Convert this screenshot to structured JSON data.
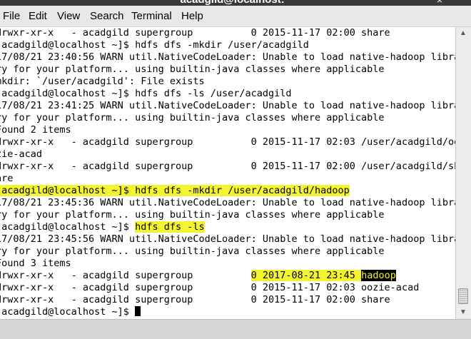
{
  "window": {
    "title": "acadgild@localhost:~",
    "close_glyph": "×"
  },
  "menu": [
    "File",
    "Edit",
    "View",
    "Search",
    "Terminal",
    "Help"
  ],
  "terminal": {
    "lines": [
      "drwxr-xr-x   - acadgild supergroup          0 2015-11-17 02:00 share",
      "[acadgild@localhost ~]$ hdfs dfs -mkdir /user/acadgild",
      "17/08/21 23:40:56 WARN util.NativeCodeLoader: Unable to load native-hadoop libra",
      "ry for your platform... using builtin-java classes where applicable",
      "mkdir: `/user/acadgild': File exists",
      "[acadgild@localhost ~]$ hdfs dfs -ls /user/acadgild",
      "17/08/21 23:41:25 WARN util.NativeCodeLoader: Unable to load native-hadoop libra",
      "ry for your platform... using builtin-java classes where applicable",
      "Found 2 items",
      "drwxr-xr-x   - acadgild supergroup          0 2015-11-17 02:03 /user/acadgild/oo",
      "zie-acad",
      "drwxr-xr-x   - acadgild supergroup          0 2015-11-17 02:00 /user/acadgild/sh",
      "are",
      "[acadgild@localhost ~]$ hdfs dfs -mkdir /user/acadgild/hadoop",
      "17/08/21 23:45:36 WARN util.NativeCodeLoader: Unable to load native-hadoop libra",
      "ry for your platform... using builtin-java classes where applicable",
      "[acadgild@localhost ~]$ ",
      "17/08/21 23:45:56 WARN util.NativeCodeLoader: Unable to load native-hadoop libra",
      "ry for your platform... using builtin-java classes where applicable",
      "Found 3 items",
      "drwxr-xr-x   - acadgild supergroup          ",
      "drwxr-xr-x   - acadgild supergroup          0 2015-11-17 02:03 oozie-acad",
      "drwxr-xr-x   - acadgild supergroup          0 2015-11-17 02:00 share",
      "[acadgild@localhost ~]$ "
    ],
    "ls_cmd": "hdfs dfs -ls",
    "new_dir_meta": "0 2017-08-21 23:45 ",
    "new_dir_name": "hadoop",
    "highlight_color": "#f4f430"
  },
  "icons": {
    "scroll_up": "scroll-up-arrow-icon",
    "scroll_down": "scroll-down-arrow-icon"
  }
}
